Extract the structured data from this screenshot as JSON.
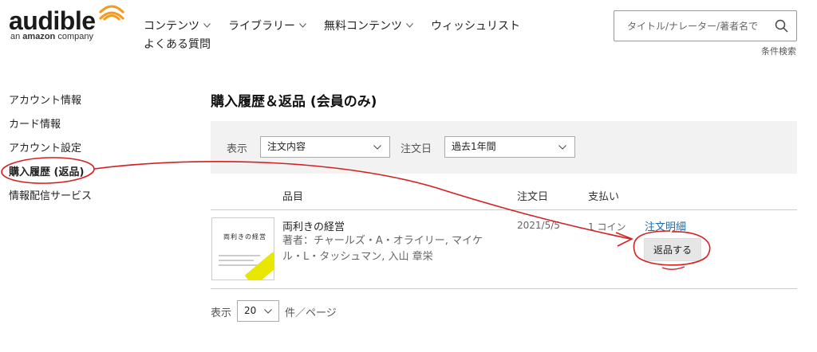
{
  "brand": {
    "logo_word": "audible",
    "logo_sub_prefix": "an ",
    "logo_sub_bold": "amazon",
    "logo_sub_suffix": " company",
    "accent": "#f7991c"
  },
  "nav": {
    "items": [
      {
        "label": "コンテンツ",
        "icon": "chevron-down-icon"
      },
      {
        "label": "ライブラリー",
        "icon": "chevron-down-icon"
      },
      {
        "label": "無料コンテンツ",
        "icon": "chevron-down-icon"
      },
      {
        "label": "ウィッシュリスト"
      }
    ],
    "faq": "よくある質問"
  },
  "search": {
    "placeholder": "タイトル/ナレーター/著者名で",
    "icon": "search-icon",
    "advanced": "条件検索"
  },
  "sidebar": {
    "items": [
      {
        "label": "アカウント情報"
      },
      {
        "label": "カード情報"
      },
      {
        "label": "アカウント設定"
      },
      {
        "label": "購入履歴 (返品)",
        "active": true
      },
      {
        "label": "情報配信サービス"
      }
    ]
  },
  "main": {
    "title": "購入履歴＆返品 (会員のみ)",
    "filters": {
      "show_label": "表示",
      "show_value": "注文内容",
      "date_label": "注文日",
      "date_value": "過去1年間"
    },
    "table": {
      "headers": {
        "item": "品目",
        "date": "注文日",
        "payment": "支払い"
      },
      "rows": [
        {
          "cover_title": "両利きの経営",
          "title": "両利きの経営",
          "author": "著者：チャールズ・A・オライリー, マイケル・L・タッシュマン, 入山 章栄",
          "date": "2021/5/5",
          "payment": "1 コイン",
          "order_link": "注文明細",
          "return_label": "返品する"
        }
      ]
    },
    "pagination": {
      "prefix": "表示",
      "value": "20",
      "suffix": "件／ページ"
    }
  },
  "annotation": {
    "color": "#d42020"
  }
}
